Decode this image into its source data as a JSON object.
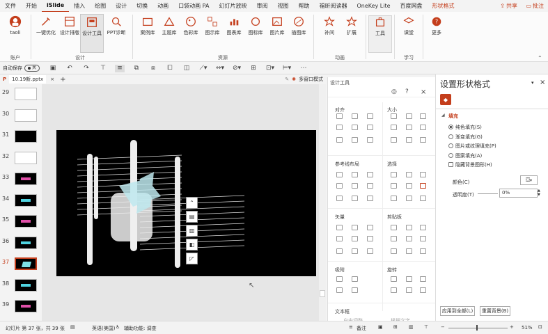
{
  "menu": [
    "文件",
    "开始",
    "iSlide",
    "插入",
    "绘图",
    "设计",
    "切换",
    "动画",
    "口袋动画 PA",
    "幻灯片放映",
    "审阅",
    "视图",
    "帮助",
    "福昕阅读器",
    "OneKey Lite",
    "百度网盘",
    "形状格式"
  ],
  "menu_active": "iSlide",
  "share": "共享",
  "comment": "批注",
  "ribbon": {
    "account": "taoli",
    "g_account": "账户",
    "b1": "一键优化",
    "b2": "设计排版",
    "b3": "设计工具",
    "b4": "PPT诊断",
    "g_design": "设计",
    "r1": "案例库",
    "r2": "主题库",
    "r3": "色彩库",
    "r4": "图示库",
    "r5": "图表库",
    "r6": "图标库",
    "r7": "图片库",
    "r8": "插图库",
    "g_res": "资源",
    "a1": "补间",
    "a2": "扩展",
    "g_anim": "动画",
    "t1": "工具",
    "c1": "课堂",
    "g_learn": "学习",
    "m1": "更多"
  },
  "qat": {
    "autosave": "自动保存",
    "toggle": "关"
  },
  "doc": {
    "name": "10.19新.pptx",
    "multi": "多窗口模式"
  },
  "slides": [
    {
      "n": "29",
      "kind": "white"
    },
    {
      "n": "30",
      "kind": "white"
    },
    {
      "n": "31",
      "kind": "black"
    },
    {
      "n": "32",
      "kind": "white"
    },
    {
      "n": "33",
      "kind": "black"
    },
    {
      "n": "34",
      "kind": "black"
    },
    {
      "n": "35",
      "kind": "black"
    },
    {
      "n": "36",
      "kind": "black"
    },
    {
      "n": "37",
      "kind": "sel"
    },
    {
      "n": "38",
      "kind": "black"
    },
    {
      "n": "39",
      "kind": "black"
    }
  ],
  "tools": {
    "title": "设计工具",
    "align": "对齐",
    "size": "大小",
    "guides": "参考线布局",
    "select": "选择",
    "vector": "矢量",
    "clipboard": "剪贴板",
    "snap": "吸附",
    "rotate": "旋转",
    "textbox": "文本框",
    "text_left": "自由调整",
    "text_right": "根据文字"
  },
  "format": {
    "title": "设置形状格式",
    "fill_header": "填充",
    "options": [
      "纯色填充(S)",
      "渐变填充(G)",
      "图片或纹理填充(P)",
      "图案填充(A)",
      "隐藏背景图形(H)"
    ],
    "color_label": "颜色(C)",
    "transparency_label": "透明度(T)",
    "transparency_value": "0%",
    "apply_all": "应用到全部(L)",
    "reset_bg": "重置背景(B)"
  },
  "status": {
    "slide": "幻灯片 第 37 张，共 39 张",
    "lang": "英语(美国)",
    "access": "辅助功能: 调查",
    "notes": "备注",
    "zoom": "51%"
  }
}
